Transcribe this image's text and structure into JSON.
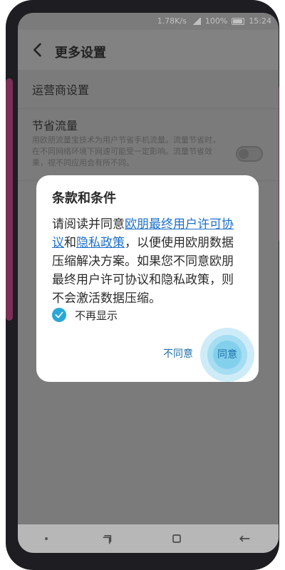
{
  "statusbar": {
    "network_speed": "1.78K/s",
    "battery_pct": "100%",
    "time": "15:24"
  },
  "appbar": {
    "title": "更多设置"
  },
  "settings": {
    "operator_label": "运营商设置",
    "save_traffic": {
      "label": "节省流量",
      "description": "用欧朋流量宝技术为用户节省手机流量。流量节省时，在不同网络环境下网速可能受一定影响。流量节省效果，视不同应用会有所不同。"
    }
  },
  "dialog": {
    "title": "条款和条件",
    "body_prefix": "请阅读并同意",
    "link_eula": "欧朋最终用户许可协议",
    "and": "和",
    "link_privacy": "隐私政策",
    "body_suffix": "，以便使用欧朋数据压缩解决方案。如果您不同意欧朋最终用户许可协议和隐私政策，则不会激活数据压缩。",
    "checkbox_label": "不再显示",
    "disagree": "不同意",
    "agree": "同意"
  },
  "icons": {
    "back": "chevron-left-icon",
    "check": "check-icon",
    "recent": "recent-apps-icon",
    "home": "home-icon",
    "back_nav": "back-arrow-icon"
  },
  "colors": {
    "accent": "#2aa7d9",
    "link": "#1b6fc9",
    "dialog_bg": "#ffffff"
  }
}
